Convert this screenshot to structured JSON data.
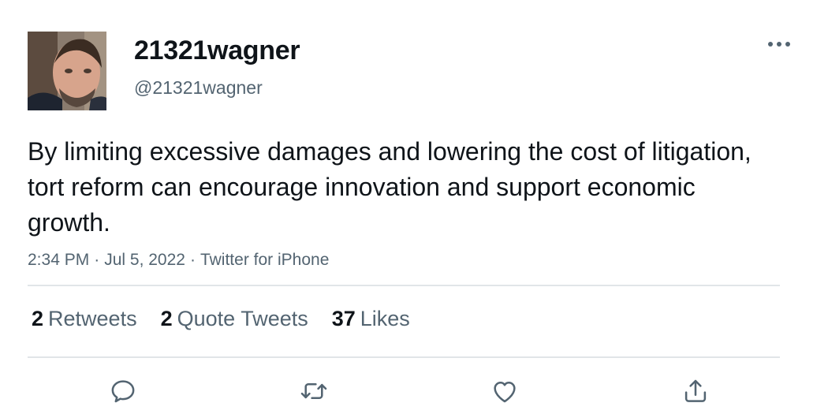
{
  "user": {
    "display_name": "21321wagner",
    "handle": "@21321wagner",
    "avatar_icon": "user-photo"
  },
  "tweet": {
    "text": "By limiting excessive damages and lowering the cost of litigation, tort reform can encourage innovation and support economic growth.",
    "time": "2:34 PM",
    "date": "Jul 5, 2022",
    "source": "Twitter for iPhone",
    "separator": "·"
  },
  "stats": {
    "retweets_count": "2",
    "retweets_label": "Retweets",
    "quotes_count": "2",
    "quotes_label": "Quote Tweets",
    "likes_count": "37",
    "likes_label": "Likes"
  },
  "actions": [
    "reply-icon",
    "retweet-icon",
    "like-icon",
    "share-icon"
  ],
  "colors": {
    "text_primary": "#0f1419",
    "text_secondary": "#536471",
    "divider": "#e1e5e8",
    "icon": "#536471"
  }
}
